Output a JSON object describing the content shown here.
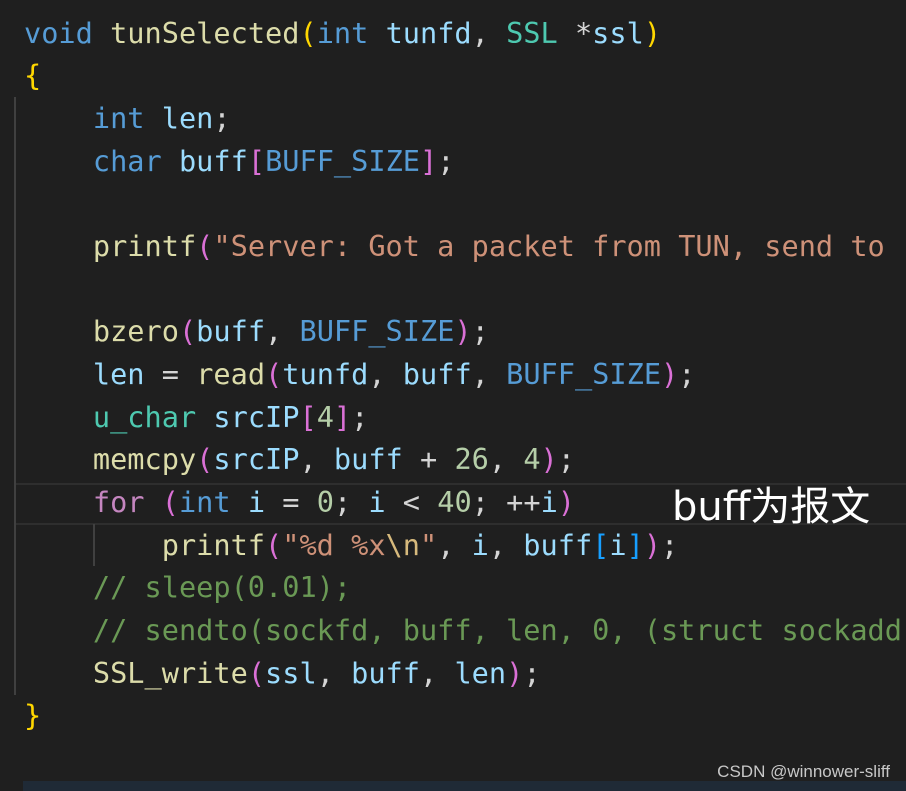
{
  "code_lines": [
    [
      [
        "void",
        "kw"
      ],
      [
        " ",
        "p"
      ],
      [
        "tunSelected",
        "fn"
      ],
      [
        "(",
        "b1"
      ],
      [
        "int",
        "kw"
      ],
      [
        " ",
        "p"
      ],
      [
        "tunfd",
        "var"
      ],
      [
        ", ",
        "p"
      ],
      [
        "SSL",
        "ty"
      ],
      [
        " *",
        "p"
      ],
      [
        "ssl",
        "var"
      ],
      [
        ")",
        "b1"
      ]
    ],
    [
      [
        "{",
        "b1"
      ]
    ],
    [
      [
        "    ",
        "p"
      ],
      [
        "int",
        "kw"
      ],
      [
        " ",
        "p"
      ],
      [
        "len",
        "var"
      ],
      [
        ";",
        "p"
      ]
    ],
    [
      [
        "    ",
        "p"
      ],
      [
        "char",
        "kw"
      ],
      [
        " ",
        "p"
      ],
      [
        "buff",
        "var"
      ],
      [
        "[",
        "b2"
      ],
      [
        "BUFF_SIZE",
        "mac"
      ],
      [
        "]",
        "b2"
      ],
      [
        ";",
        "p"
      ]
    ],
    [],
    [
      [
        "    ",
        "p"
      ],
      [
        "printf",
        "fn"
      ],
      [
        "(",
        "b2"
      ],
      [
        "\"Server: Got a packet from TUN, send to",
        "str"
      ]
    ],
    [],
    [
      [
        "    ",
        "p"
      ],
      [
        "bzero",
        "fn"
      ],
      [
        "(",
        "b2"
      ],
      [
        "buff",
        "var"
      ],
      [
        ", ",
        "p"
      ],
      [
        "BUFF_SIZE",
        "mac"
      ],
      [
        ")",
        "b2"
      ],
      [
        ";",
        "p"
      ]
    ],
    [
      [
        "    ",
        "p"
      ],
      [
        "len",
        "var"
      ],
      [
        " = ",
        "p"
      ],
      [
        "read",
        "fn"
      ],
      [
        "(",
        "b2"
      ],
      [
        "tunfd",
        "var"
      ],
      [
        ", ",
        "p"
      ],
      [
        "buff",
        "var"
      ],
      [
        ", ",
        "p"
      ],
      [
        "BUFF_SIZE",
        "mac"
      ],
      [
        ")",
        "b2"
      ],
      [
        ";",
        "p"
      ]
    ],
    [
      [
        "    ",
        "p"
      ],
      [
        "u_char",
        "ty"
      ],
      [
        " ",
        "p"
      ],
      [
        "srcIP",
        "var"
      ],
      [
        "[",
        "b2"
      ],
      [
        "4",
        "num"
      ],
      [
        "]",
        "b2"
      ],
      [
        ";",
        "p"
      ]
    ],
    [
      [
        "    ",
        "p"
      ],
      [
        "memcpy",
        "fn"
      ],
      [
        "(",
        "b2"
      ],
      [
        "srcIP",
        "var"
      ],
      [
        ", ",
        "p"
      ],
      [
        "buff",
        "var"
      ],
      [
        " + ",
        "p"
      ],
      [
        "26",
        "num"
      ],
      [
        ", ",
        "p"
      ],
      [
        "4",
        "num"
      ],
      [
        ")",
        "b2"
      ],
      [
        ";",
        "p"
      ]
    ],
    [
      [
        "    ",
        "p"
      ],
      [
        "for",
        "ctl"
      ],
      [
        " ",
        "p"
      ],
      [
        "(",
        "b2"
      ],
      [
        "int",
        "kw"
      ],
      [
        " ",
        "p"
      ],
      [
        "i",
        "var"
      ],
      [
        " = ",
        "p"
      ],
      [
        "0",
        "num"
      ],
      [
        "; ",
        "p"
      ],
      [
        "i",
        "var"
      ],
      [
        " < ",
        "p"
      ],
      [
        "40",
        "num"
      ],
      [
        "; ++",
        "p"
      ],
      [
        "i",
        "var"
      ],
      [
        ")",
        "b2"
      ]
    ],
    [
      [
        "        ",
        "p"
      ],
      [
        "printf",
        "fn"
      ],
      [
        "(",
        "b2"
      ],
      [
        "\"%d %x",
        "str"
      ],
      [
        "\\n",
        "esc"
      ],
      [
        "\"",
        "str"
      ],
      [
        ", ",
        "p"
      ],
      [
        "i",
        "var"
      ],
      [
        ", ",
        "p"
      ],
      [
        "buff",
        "var"
      ],
      [
        "[",
        "b3"
      ],
      [
        "i",
        "var"
      ],
      [
        "]",
        "b3"
      ],
      [
        ")",
        "b2"
      ],
      [
        ";",
        "p"
      ]
    ],
    [
      [
        "    ",
        "p"
      ],
      [
        "// sleep(0.01);",
        "cm"
      ]
    ],
    [
      [
        "    ",
        "p"
      ],
      [
        "// sendto(sockfd, buff, len, 0, (struct sockadd",
        "cm"
      ]
    ],
    [
      [
        "    ",
        "p"
      ],
      [
        "SSL_write",
        "fn"
      ],
      [
        "(",
        "b2"
      ],
      [
        "ssl",
        "var"
      ],
      [
        ", ",
        "p"
      ],
      [
        "buff",
        "var"
      ],
      [
        ", ",
        "p"
      ],
      [
        "len",
        "var"
      ],
      [
        ")",
        "b2"
      ],
      [
        ";",
        "p"
      ]
    ],
    [
      [
        "}",
        "b1"
      ]
    ]
  ],
  "annotation": "buff为报文",
  "watermark": "CSDN @winnower-sliff"
}
